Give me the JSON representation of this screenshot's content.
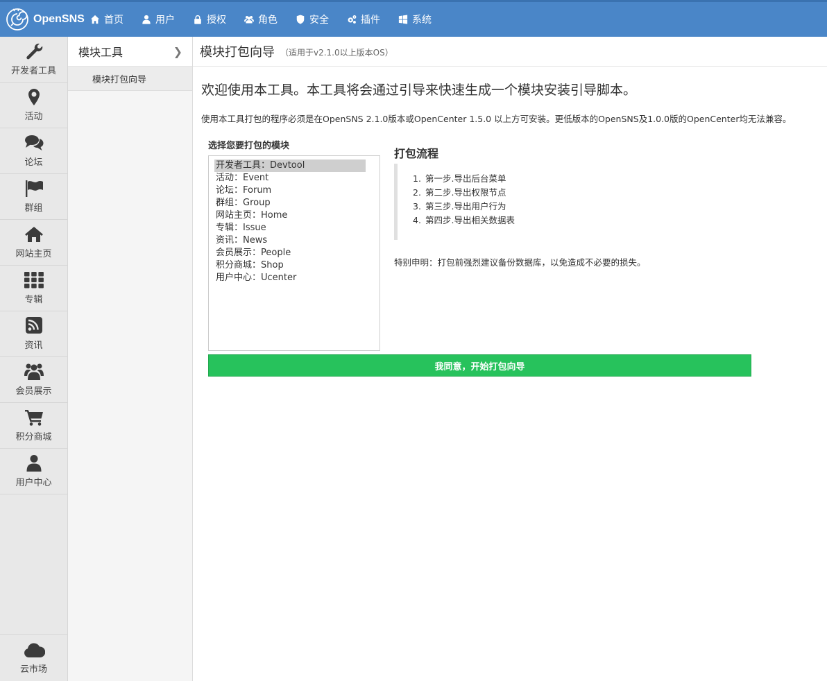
{
  "brand": {
    "name": "OpenSNS"
  },
  "topnav": [
    {
      "label": "首页",
      "icon": "home-icon"
    },
    {
      "label": "用户",
      "icon": "user-icon"
    },
    {
      "label": "授权",
      "icon": "lock-icon"
    },
    {
      "label": "角色",
      "icon": "group-icon"
    },
    {
      "label": "安全",
      "icon": "shield-icon"
    },
    {
      "label": "插件",
      "icon": "cogs-icon"
    },
    {
      "label": "系统",
      "icon": "windows-icon"
    }
  ],
  "sidebar": {
    "items": [
      {
        "label": "开发者工具",
        "icon": "wrench-icon"
      },
      {
        "label": "活动",
        "icon": "map-marker-icon"
      },
      {
        "label": "论坛",
        "icon": "comments-icon"
      },
      {
        "label": "群组",
        "icon": "flag-icon"
      },
      {
        "label": "网站主页",
        "icon": "home-icon"
      },
      {
        "label": "专辑",
        "icon": "grid-icon"
      },
      {
        "label": "资讯",
        "icon": "rss-icon"
      },
      {
        "label": "会员展示",
        "icon": "users-icon"
      },
      {
        "label": "积分商城",
        "icon": "cart-icon"
      },
      {
        "label": "用户中心",
        "icon": "user-icon"
      }
    ],
    "bottom": {
      "label": "云市场",
      "icon": "cloud-icon"
    }
  },
  "subbar": {
    "title": "模块工具",
    "items": [
      {
        "label": "模块打包向导"
      }
    ]
  },
  "main": {
    "title": "模块打包向导",
    "subtitle": "（适用于v2.1.0以上版本OS）",
    "welcome": "欢迎使用本工具。本工具将会通过引导来快速生成一个模块安装引导脚本。",
    "notice": "使用本工具打包的程序必须是在OpenSNS 2.1.0版本或OpenCenter 1.5.0 以上方可安装。更低版本的OpenSNS及1.0.0版的OpenCenter均无法兼容。",
    "select_label": "选择您要打包的模块",
    "modules": [
      "开发者工具：Devtool",
      "活动：Event",
      "论坛：Forum",
      "群组：Group",
      "网站主页：Home",
      "专辑：Issue",
      "资讯：News",
      "会员展示：People",
      "积分商城：Shop",
      "用户中心：Ucenter"
    ],
    "selected_module": "开发者工具：Devtool",
    "flow_title": "打包流程",
    "flow_steps": [
      {
        "num": "1.",
        "text": "第一步.导出后台菜单"
      },
      {
        "num": "2.",
        "text": "第二步.导出权限节点"
      },
      {
        "num": "3.",
        "text": "第三步.导出用户行为"
      },
      {
        "num": "4.",
        "text": "第四步.导出相关数据表"
      }
    ],
    "disclaimer": "特别申明：打包前强烈建议备份数据库，以免造成不必要的损失。",
    "agree_button": "我同意，开始打包向导"
  },
  "colors": {
    "topbar": "#4a86c8",
    "button": "#27c25c",
    "sidebar": "#e8e8e8"
  }
}
